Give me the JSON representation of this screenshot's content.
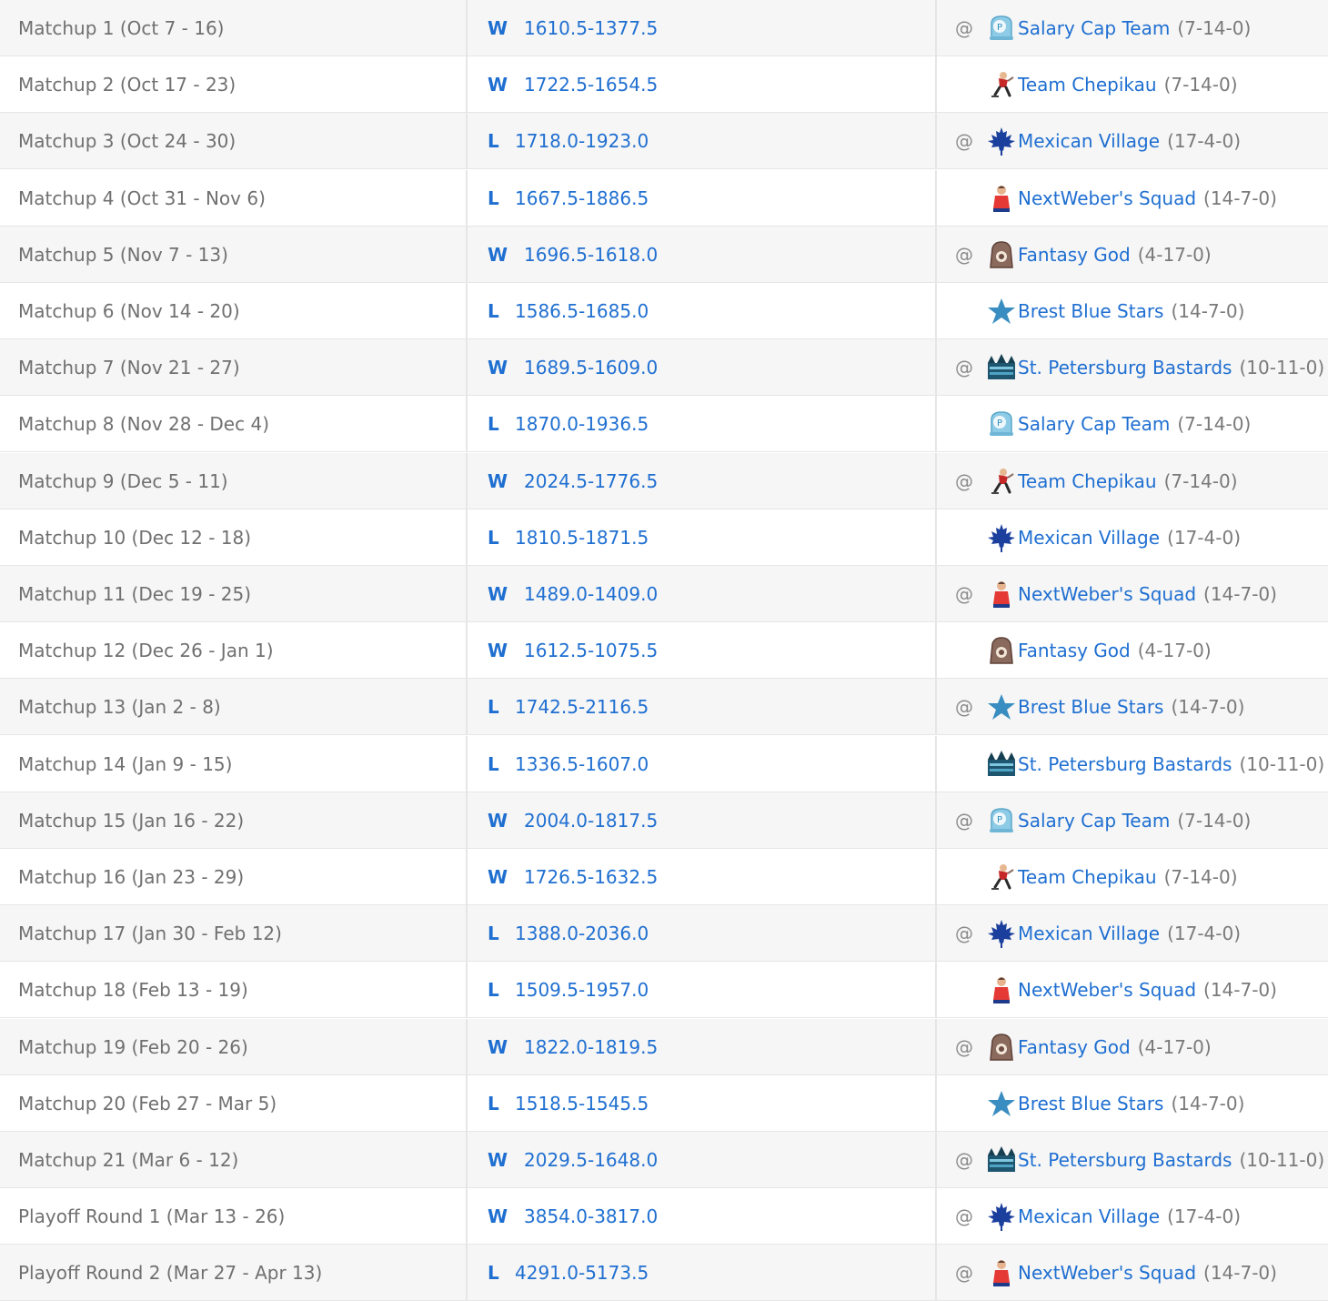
{
  "rows": [
    {
      "period": "Matchup 1 (Oct 7 - 16)",
      "result": "W",
      "score": "1610.5-1377.5",
      "at": "@",
      "team": "Salary Cap Team",
      "record": "(7-14-0)",
      "logo": "salary-cap-logo-icon"
    },
    {
      "period": "Matchup 2 (Oct 17 - 23)",
      "result": "W",
      "score": "1722.5-1654.5",
      "at": "",
      "team": "Team Chepikau",
      "record": "(7-14-0)",
      "logo": "chepikau-logo-icon"
    },
    {
      "period": "Matchup 3 (Oct 24 - 30)",
      "result": "L",
      "score": "1718.0-1923.0",
      "at": "@",
      "team": "Mexican Village",
      "record": "(17-4-0)",
      "logo": "maple-leaf-logo-icon"
    },
    {
      "period": "Matchup 4 (Oct 31 - Nov 6)",
      "result": "L",
      "score": "1667.5-1886.5",
      "at": "",
      "team": "NextWeber's Squad",
      "record": "(14-7-0)",
      "logo": "nextweber-logo-icon"
    },
    {
      "period": "Matchup 5 (Nov 7 - 13)",
      "result": "W",
      "score": "1696.5-1618.0",
      "at": "@",
      "team": "Fantasy God",
      "record": "(4-17-0)",
      "logo": "fantasy-god-logo-icon"
    },
    {
      "period": "Matchup 6 (Nov 14 - 20)",
      "result": "L",
      "score": "1586.5-1685.0",
      "at": "",
      "team": "Brest Blue Stars",
      "record": "(14-7-0)",
      "logo": "star-logo-icon"
    },
    {
      "period": "Matchup 7 (Nov 21 - 27)",
      "result": "W",
      "score": "1689.5-1609.0",
      "at": "@",
      "team": "St. Petersburg Bastards",
      "record": "(10-11-0)",
      "logo": "bastards-logo-icon"
    },
    {
      "period": "Matchup 8 (Nov 28 - Dec 4)",
      "result": "L",
      "score": "1870.0-1936.5",
      "at": "",
      "team": "Salary Cap Team",
      "record": "(7-14-0)",
      "logo": "salary-cap-logo-icon"
    },
    {
      "period": "Matchup 9 (Dec 5 - 11)",
      "result": "W",
      "score": "2024.5-1776.5",
      "at": "@",
      "team": "Team Chepikau",
      "record": "(7-14-0)",
      "logo": "chepikau-logo-icon"
    },
    {
      "period": "Matchup 10 (Dec 12 - 18)",
      "result": "L",
      "score": "1810.5-1871.5",
      "at": "",
      "team": "Mexican Village",
      "record": "(17-4-0)",
      "logo": "maple-leaf-logo-icon"
    },
    {
      "period": "Matchup 11 (Dec 19 - 25)",
      "result": "W",
      "score": "1489.0-1409.0",
      "at": "@",
      "team": "NextWeber's Squad",
      "record": "(14-7-0)",
      "logo": "nextweber-logo-icon"
    },
    {
      "period": "Matchup 12 (Dec 26 - Jan 1)",
      "result": "W",
      "score": "1612.5-1075.5",
      "at": "",
      "team": "Fantasy God",
      "record": "(4-17-0)",
      "logo": "fantasy-god-logo-icon"
    },
    {
      "period": "Matchup 13 (Jan 2 - 8)",
      "result": "L",
      "score": "1742.5-2116.5",
      "at": "@",
      "team": "Brest Blue Stars",
      "record": "(14-7-0)",
      "logo": "star-logo-icon"
    },
    {
      "period": "Matchup 14 (Jan 9 - 15)",
      "result": "L",
      "score": "1336.5-1607.0",
      "at": "",
      "team": "St. Petersburg Bastards",
      "record": "(10-11-0)",
      "logo": "bastards-logo-icon"
    },
    {
      "period": "Matchup 15 (Jan 16 - 22)",
      "result": "W",
      "score": "2004.0-1817.5",
      "at": "@",
      "team": "Salary Cap Team",
      "record": "(7-14-0)",
      "logo": "salary-cap-logo-icon"
    },
    {
      "period": "Matchup 16 (Jan 23 - 29)",
      "result": "W",
      "score": "1726.5-1632.5",
      "at": "",
      "team": "Team Chepikau",
      "record": "(7-14-0)",
      "logo": "chepikau-logo-icon"
    },
    {
      "period": "Matchup 17 (Jan 30 - Feb 12)",
      "result": "L",
      "score": "1388.0-2036.0",
      "at": "@",
      "team": "Mexican Village",
      "record": "(17-4-0)",
      "logo": "maple-leaf-logo-icon"
    },
    {
      "period": "Matchup 18 (Feb 13 - 19)",
      "result": "L",
      "score": "1509.5-1957.0",
      "at": "",
      "team": "NextWeber's Squad",
      "record": "(14-7-0)",
      "logo": "nextweber-logo-icon"
    },
    {
      "period": "Matchup 19 (Feb 20 - 26)",
      "result": "W",
      "score": "1822.0-1819.5",
      "at": "@",
      "team": "Fantasy God",
      "record": "(4-17-0)",
      "logo": "fantasy-god-logo-icon"
    },
    {
      "period": "Matchup 20 (Feb 27 - Mar 5)",
      "result": "L",
      "score": "1518.5-1545.5",
      "at": "",
      "team": "Brest Blue Stars",
      "record": "(14-7-0)",
      "logo": "star-logo-icon"
    },
    {
      "period": "Matchup 21 (Mar 6 - 12)",
      "result": "W",
      "score": "2029.5-1648.0",
      "at": "@",
      "team": "St. Petersburg Bastards",
      "record": "(10-11-0)",
      "logo": "bastards-logo-icon"
    },
    {
      "period": "Playoff Round 1 (Mar 13 - 26)",
      "result": "W",
      "score": "3854.0-3817.0",
      "at": "@",
      "team": "Mexican Village",
      "record": "(17-4-0)",
      "logo": "maple-leaf-logo-icon"
    },
    {
      "period": "Playoff Round 2 (Mar 27 - Apr 13)",
      "result": "L",
      "score": "4291.0-5173.5",
      "at": "@",
      "team": "NextWeber's Squad",
      "record": "(14-7-0)",
      "logo": "nextweber-logo-icon"
    }
  ]
}
